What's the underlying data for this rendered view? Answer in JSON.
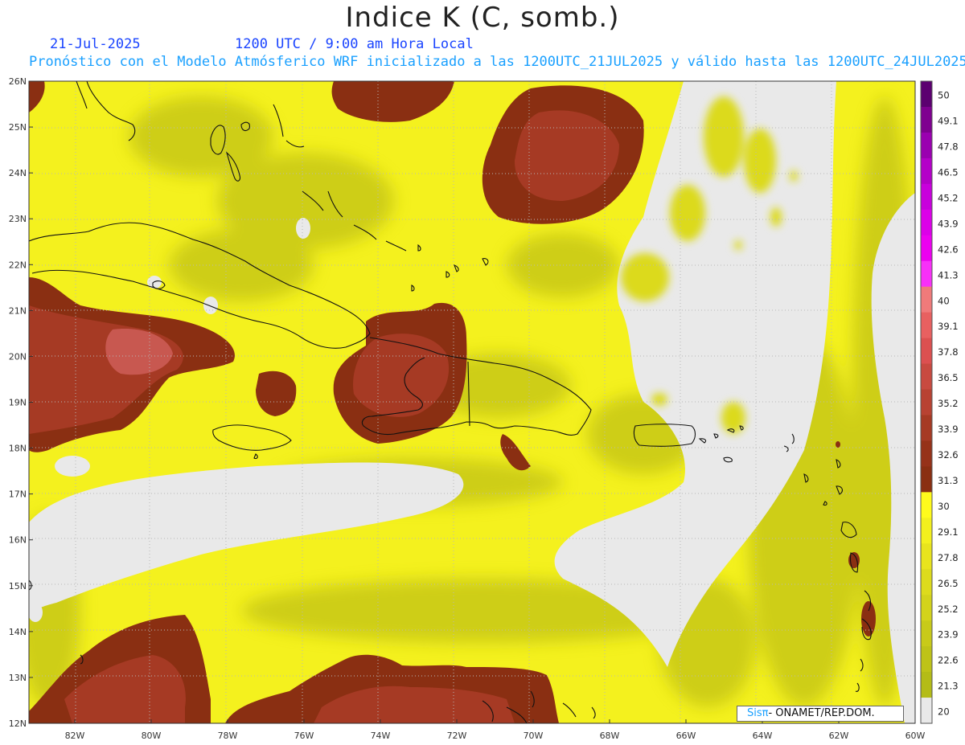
{
  "header": {
    "title": "Indice K (C, somb.)",
    "date": "21-Jul-2025",
    "time": "1200 UTC / 9:00 am Hora Local",
    "forecast": "Pronóstico con el Modelo Atmósferico WRF inicializado a las 1200UTC_21JUL2025 y válido hasta las  1200UTC_24JUL2025"
  },
  "map": {
    "lon_labels": [
      "82W",
      "80W",
      "78W",
      "76W",
      "74W",
      "72W",
      "70W",
      "68W",
      "66W",
      "64W",
      "62W",
      "60W"
    ],
    "lat_labels": [
      "26N",
      "25N",
      "24N",
      "23N",
      "22N",
      "21N",
      "20N",
      "19N",
      "18N",
      "17N",
      "16N",
      "15N",
      "14N",
      "13N",
      "12N"
    ],
    "lon_range": [
      -83.2,
      -60.0
    ],
    "lat_range": [
      12.0,
      26.0
    ]
  },
  "colorbar": {
    "levels": [
      "50",
      "49.1",
      "47.8",
      "46.5",
      "45.2",
      "43.9",
      "42.6",
      "41.3",
      "40",
      "39.1",
      "37.8",
      "36.5",
      "35.2",
      "33.9",
      "32.6",
      "31.3",
      "30",
      "29.1",
      "27.8",
      "26.5",
      "25.2",
      "23.9",
      "22.6",
      "21.3",
      "20"
    ],
    "colors": [
      "#5c0070",
      "#7f0090",
      "#9a00b0",
      "#b400c8",
      "#c800dc",
      "#dc00e8",
      "#ec00f0",
      "#f830f8",
      "#f07a7a",
      "#e86060",
      "#dc5050",
      "#c84a40",
      "#b84232",
      "#a63a24",
      "#963219",
      "#8a2f12",
      "#fffb1c",
      "#f3f01e",
      "#e8e41d",
      "#dddb1c",
      "#d3d31b",
      "#c8ca19",
      "#bec318",
      "#b4bc17",
      "#e9e9e9"
    ]
  },
  "credit": {
    "prefix": "Sis",
    "pi": "π",
    "suffix": "- ONAMET/REP.DOM."
  }
}
